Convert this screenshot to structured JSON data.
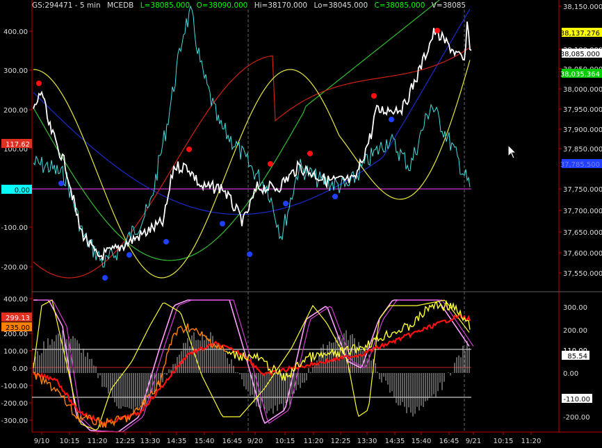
{
  "header": {
    "symbol": "GS:294471 - 5 min",
    "study": "MCEDB",
    "last": "L=38085.000",
    "open": "O=38090.000",
    "high": "Hi=38170.000",
    "low": "Lo=38045.000",
    "close": "C=38085.000",
    "volume": "V=38085",
    "colors": {
      "last": "#00ff00",
      "open": "#00ff00",
      "close": "#00ff00",
      "default": "#dddddd"
    }
  },
  "upper_left_axis": [
    "400.00",
    "300.00",
    "200.00",
    "100.00",
    "-100.00",
    "-200.00"
  ],
  "upper_left_flags": [
    {
      "text": "117.62",
      "bg": "#e03020",
      "fg": "#ffffff"
    },
    {
      "text": "0.00",
      "bg": "#00ffff",
      "fg": "#000000"
    }
  ],
  "upper_right_axis": [
    "38,150.000",
    "38,100.000",
    "38,050.000",
    "38,000.000",
    "37,950.000",
    "37,900.000",
    "37,850.000",
    "37,750.000",
    "37,700.000",
    "37,650.000",
    "37,600.000",
    "37,550.000"
  ],
  "upper_right_flags": [
    {
      "text": "38,137.276",
      "bg": "#ffff00",
      "fg": "#000000"
    },
    {
      "text": "38,085.000",
      "bg": "#ffffff",
      "fg": "#000000"
    },
    {
      "text": "38,035.364",
      "bg": "#00cc00",
      "fg": "#ffffff"
    },
    {
      "text": "37,785.500",
      "bg": "#2040ff",
      "fg": "#8080ff"
    }
  ],
  "lower_left_axis": [
    "400.00",
    "300.00",
    "200.00",
    "100.00",
    "0.00",
    "-100.00",
    "-200.00",
    "-300.00"
  ],
  "lower_left_flags": [
    {
      "text": "299.13",
      "bg": "#e03020",
      "fg": "#ffffff"
    },
    {
      "text": "235.00",
      "bg": "#ff8000",
      "fg": "#000000"
    }
  ],
  "lower_right_axis": [
    "300.00",
    "200.00",
    "0.00",
    "-200.00"
  ],
  "lower_right_flags": [
    {
      "text": "110.00",
      "bg": "#000000",
      "fg": "#ffffff"
    },
    {
      "text": "85.54",
      "bg": "#ffffff",
      "fg": "#000000"
    },
    {
      "text": "-110.00",
      "bg": "#ffffff",
      "fg": "#000000"
    }
  ],
  "time_axis": [
    "9/10",
    "10:15",
    "11:20",
    "12:25",
    "13:30",
    "14:35",
    "15:40",
    "16:45",
    "9/20",
    "10:15",
    "11:20",
    "12:25",
    "13:30",
    "14:35",
    "15:40",
    "16:45",
    "9/21",
    "10:15",
    "11:20"
  ],
  "icons": {
    "cursor": "mouse-pointer-icon"
  },
  "colors": {
    "price": "#ffffff",
    "cyan": "#40e0e0",
    "red": "#d02010",
    "yellow": "#e8e840",
    "green": "#30c030",
    "blue": "#1a2ad0",
    "magenta": "#d040d0",
    "orange": "#ff8000",
    "axis": "#c00000",
    "zero": "#ff40ff",
    "dot_red": "#ff1010",
    "dot_blue": "#2040ff",
    "osc_pink": "#ffa0ff",
    "osc_yellow": "#ffff30",
    "osc_red": "#ff1010",
    "osc_orange": "#ff8000",
    "histogram": "#bbbbbb"
  }
}
